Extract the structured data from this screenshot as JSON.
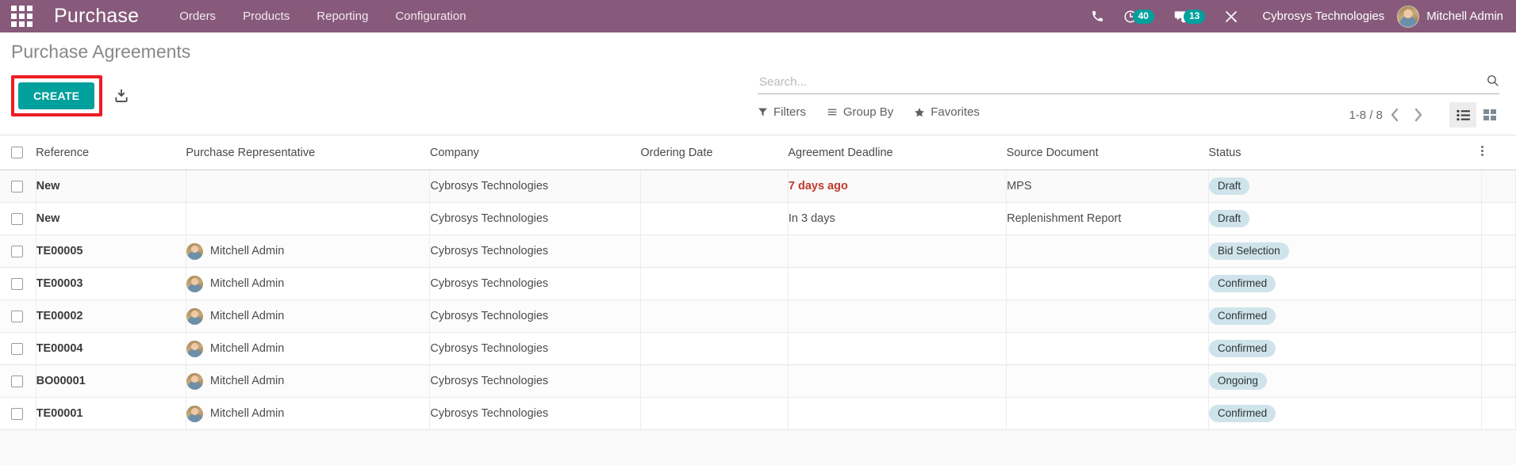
{
  "navbar": {
    "apps_icon": "apps-grid-icon",
    "brand": "Purchase",
    "menu": [
      {
        "label": "Orders"
      },
      {
        "label": "Products"
      },
      {
        "label": "Reporting"
      },
      {
        "label": "Configuration"
      }
    ],
    "phone_icon": "phone-icon",
    "activity_icon": "clock-activity-icon",
    "activity_count": "40",
    "messages_icon": "chat-bubble-icon",
    "messages_count": "13",
    "debug_icon": "wrench-tools-icon",
    "company": "Cybrosys Technologies",
    "user_avatar": "user-avatar",
    "user_name": "Mitchell Admin",
    "bg_color": "#875a7b"
  },
  "control_panel": {
    "title": "Purchase Agreements",
    "create_label": "CREATE",
    "create_color": "#00a09d",
    "highlight_color": "#ee1c25",
    "import_icon": "import-download-icon",
    "search": {
      "placeholder": "Search...",
      "value": "",
      "icon": "search-icon"
    },
    "filters": [
      {
        "label": "Filters",
        "icon": "filter-funnel-icon"
      },
      {
        "label": "Group By",
        "icon": "group-by-lines-icon"
      },
      {
        "label": "Favorites",
        "icon": "star-icon"
      }
    ],
    "pager": {
      "count": "1-8 / 8",
      "prev_icon": "chevron-left-icon",
      "next_icon": "chevron-right-icon"
    },
    "views": [
      {
        "name": "list",
        "icon": "list-view-icon",
        "active": true
      },
      {
        "name": "kanban",
        "icon": "kanban-view-icon",
        "active": false
      }
    ]
  },
  "table": {
    "columns": [
      "Reference",
      "Purchase Representative",
      "Company",
      "Ordering Date",
      "Agreement Deadline",
      "Source Document",
      "Status"
    ],
    "optional_columns_icon": "vertical-dots-icon",
    "rows": [
      {
        "reference": "New",
        "representative": "",
        "company": "Cybrosys Technologies",
        "ordering_date": "",
        "agreement_deadline": "7 days ago",
        "deadline_late": true,
        "source_document": "MPS",
        "status": "Draft"
      },
      {
        "reference": "New",
        "representative": "",
        "company": "Cybrosys Technologies",
        "ordering_date": "",
        "agreement_deadline": "In 3 days",
        "deadline_late": false,
        "source_document": "Replenishment Report",
        "status": "Draft"
      },
      {
        "reference": "TE00005",
        "representative": "Mitchell Admin",
        "company": "Cybrosys Technologies",
        "ordering_date": "",
        "agreement_deadline": "",
        "deadline_late": false,
        "source_document": "",
        "status": "Bid Selection"
      },
      {
        "reference": "TE00003",
        "representative": "Mitchell Admin",
        "company": "Cybrosys Technologies",
        "ordering_date": "",
        "agreement_deadline": "",
        "deadline_late": false,
        "source_document": "",
        "status": "Confirmed"
      },
      {
        "reference": "TE00002",
        "representative": "Mitchell Admin",
        "company": "Cybrosys Technologies",
        "ordering_date": "",
        "agreement_deadline": "",
        "deadline_late": false,
        "source_document": "",
        "status": "Confirmed"
      },
      {
        "reference": "TE00004",
        "representative": "Mitchell Admin",
        "company": "Cybrosys Technologies",
        "ordering_date": "",
        "agreement_deadline": "",
        "deadline_late": false,
        "source_document": "",
        "status": "Confirmed"
      },
      {
        "reference": "BO00001",
        "representative": "Mitchell Admin",
        "company": "Cybrosys Technologies",
        "ordering_date": "",
        "agreement_deadline": "",
        "deadline_late": false,
        "source_document": "",
        "status": "Ongoing"
      },
      {
        "reference": "TE00001",
        "representative": "Mitchell Admin",
        "company": "Cybrosys Technologies",
        "ordering_date": "",
        "agreement_deadline": "",
        "deadline_late": false,
        "source_document": "",
        "status": "Confirmed"
      }
    ]
  }
}
